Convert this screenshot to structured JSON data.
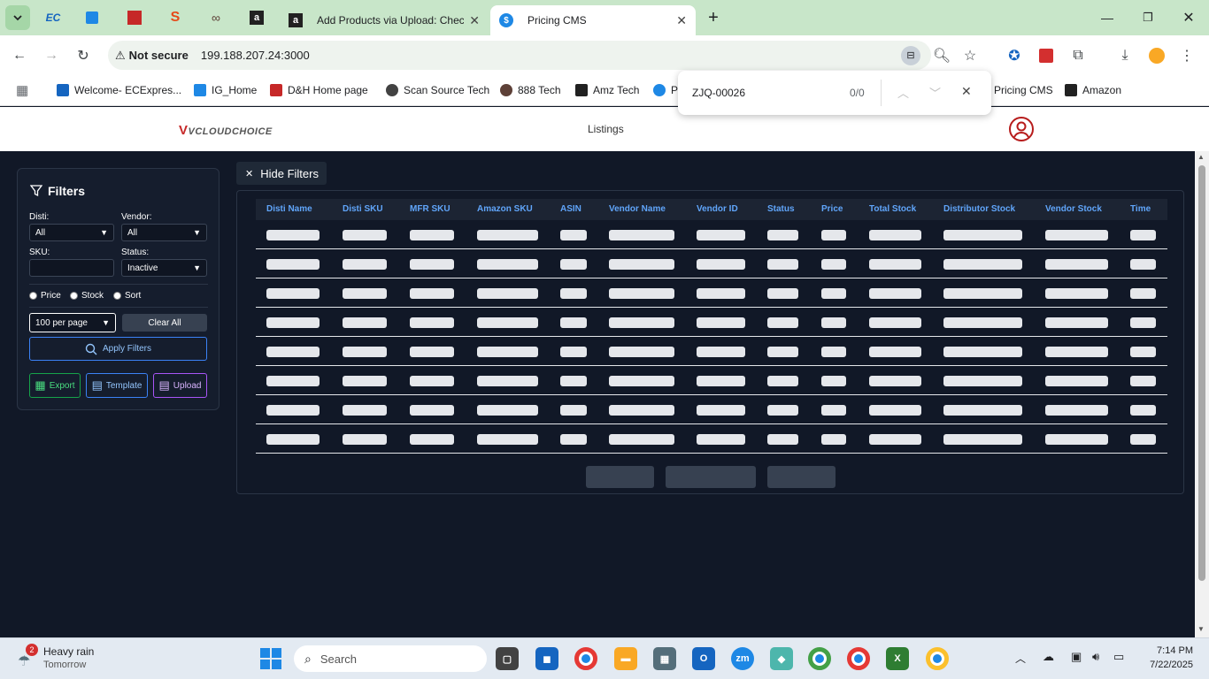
{
  "browser": {
    "tabs": [
      {
        "label": "Add Products via Upload: Chec",
        "active": false
      },
      {
        "label": "Pricing CMS",
        "active": true
      }
    ],
    "address": {
      "security": "Not secure",
      "url": "199.188.207.24:3000"
    },
    "bookmarks": [
      {
        "label": "Welcome- ECExpres...",
        "color": "#1565c0"
      },
      {
        "label": "IG_Home",
        "color": "#1e88e5"
      },
      {
        "label": "D&H Home page",
        "color": "#c62828"
      },
      {
        "label": "Scan Source Tech",
        "color": "#424242"
      },
      {
        "label": "888 Tech",
        "color": "#5d4037"
      },
      {
        "label": "Amz Tech",
        "color": "#212121"
      },
      {
        "label": "Pricing CMS",
        "color": "#1976d2"
      },
      {
        "label": "Amazon",
        "color": "#212121"
      }
    ],
    "find": {
      "query": "ZJQ-00026",
      "count": "0/0"
    }
  },
  "app": {
    "logo": "VCLOUDCHOICE",
    "nav_listings": "Listings",
    "hide_filters": "Hide Filters",
    "filters": {
      "title": "Filters",
      "disti_label": "Disti:",
      "disti_value": "All",
      "vendor_label": "Vendor:",
      "vendor_value": "All",
      "sku_label": "SKU:",
      "sku_value": "",
      "status_label": "Status:",
      "status_value": "Inactive",
      "radio_price": "Price",
      "radio_stock": "Stock",
      "radio_sort": "Sort",
      "per_page": "100 per page",
      "clear_all": "Clear All",
      "apply": "Apply Filters",
      "export": "Export",
      "template": "Template",
      "upload": "Upload"
    },
    "table": {
      "columns": [
        "Disti Name",
        "Disti SKU",
        "MFR SKU",
        "Amazon SKU",
        "ASIN",
        "Vendor Name",
        "Vendor ID",
        "Status",
        "Price",
        "Total Stock",
        "Distributor Stock",
        "Vendor Stock",
        "Time"
      ],
      "row_count": 8
    }
  },
  "taskbar": {
    "weather_badge": "2",
    "weather_title": "Heavy rain",
    "weather_sub": "Tomorrow",
    "search_placeholder": "Search",
    "time": "7:14 PM",
    "date": "7/22/2025"
  }
}
